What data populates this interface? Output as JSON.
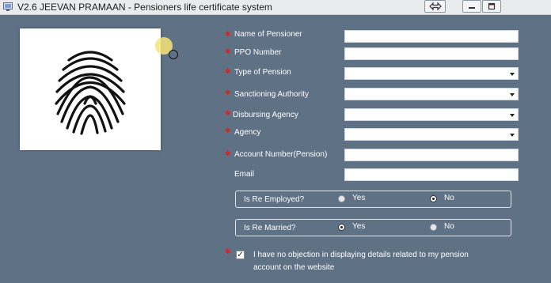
{
  "window": {
    "title": "V2.6 JEEVAN PRAMAAN - Pensioners life certificate system"
  },
  "form": {
    "name_of_pensioner": {
      "label": "Name of Pensioner",
      "value": ""
    },
    "ppo_number": {
      "label": "PPO Number",
      "value": ""
    },
    "type_of_pension": {
      "label": "Type of Pension",
      "value": ""
    },
    "sanctioning_authority": {
      "label": "Sanctioning Authority",
      "value": ""
    },
    "disbursing_agency": {
      "label": "Disbursing Agency",
      "value": ""
    },
    "agency": {
      "label": "Agency",
      "value": ""
    },
    "account_number": {
      "label": "Account Number(Pension)",
      "value": ""
    },
    "email": {
      "label": "Email",
      "value": ""
    },
    "re_employed": {
      "label": "Is Re Employed?",
      "yes_label": "Yes",
      "no_label": "No",
      "selected": "No"
    },
    "re_married": {
      "label": "Is Re Married?",
      "yes_label": "Yes",
      "no_label": "No",
      "selected": "Yes"
    },
    "consent": {
      "line1": "I have no objection in displaying details related to my pension",
      "line2": "account on the website",
      "checked": true
    }
  },
  "icons": {
    "fingerprint": "fingerprint-icon",
    "app": "app-icon",
    "swap": "swap-icon",
    "minimize": "minimize-icon",
    "restore": "restore-icon",
    "required": "required-star"
  },
  "colors": {
    "background": "#5f7185",
    "required": "#e02020"
  }
}
